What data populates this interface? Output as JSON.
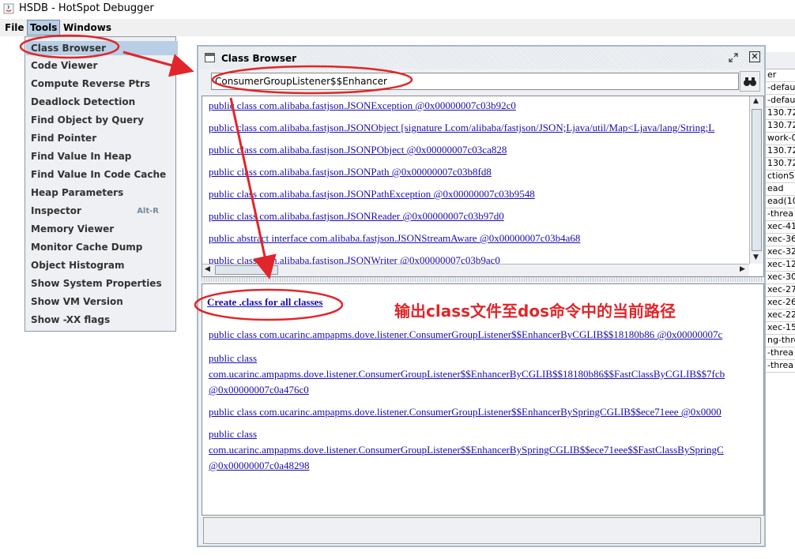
{
  "app": {
    "title": "HSDB - HotSpot Debugger"
  },
  "menubar": {
    "items": [
      "File",
      "Tools",
      "Windows"
    ]
  },
  "tools_menu": {
    "items": [
      {
        "label": "Class Browser",
        "shortcut": ""
      },
      {
        "label": "Code Viewer",
        "shortcut": ""
      },
      {
        "label": "Compute Reverse Ptrs",
        "shortcut": ""
      },
      {
        "label": "Deadlock Detection",
        "shortcut": ""
      },
      {
        "label": "Find Object by Query",
        "shortcut": ""
      },
      {
        "label": "Find Pointer",
        "shortcut": ""
      },
      {
        "label": "Find Value In Heap",
        "shortcut": ""
      },
      {
        "label": "Find Value In Code Cache",
        "shortcut": ""
      },
      {
        "label": "Heap Parameters",
        "shortcut": ""
      },
      {
        "label": "Inspector",
        "shortcut": "Alt-R"
      },
      {
        "label": "Memory Viewer",
        "shortcut": ""
      },
      {
        "label": "Monitor Cache Dump",
        "shortcut": ""
      },
      {
        "label": "Object Histogram",
        "shortcut": ""
      },
      {
        "label": "Show System Properties",
        "shortcut": ""
      },
      {
        "label": "Show VM Version",
        "shortcut": ""
      },
      {
        "label": "Show -XX flags",
        "shortcut": ""
      }
    ]
  },
  "class_browser": {
    "title": "Class Browser",
    "search_value": "ConsumerGroupListener$$Enhancer",
    "top_list": [
      "public class com.alibaba.fastjson.JSONException @0x00000007c03b92c0",
      "public class com.alibaba.fastjson.JSONObject [signature Lcom/alibaba/fastjson/JSON;Ljava/util/Map<Ljava/lang/String;L",
      "public class com.alibaba.fastjson.JSONPObject @0x00000007c03ca828",
      "public class com.alibaba.fastjson.JSONPath @0x00000007c03b8fd8",
      "public class com.alibaba.fastjson.JSONPathException @0x00000007c03b9548",
      "public class com.alibaba.fastjson.JSONReader @0x00000007c03b97d0",
      "public abstract interface com.alibaba.fastjson.JSONStreamAware @0x00000007c03b4a68",
      "public class com.alibaba.fastjson.JSONWriter @0x00000007c03b9ac0"
    ],
    "create_link": "Create .class for all classes",
    "bottom_list": [
      [
        "public class com.ucarinc.ampapms.dove.listener.ConsumerGroupListener$$EnhancerByCGLIB$$18180b86 @0x00000007c"
      ],
      [
        "public class",
        "com.ucarinc.ampapms.dove.listener.ConsumerGroupListener$$EnhancerByCGLIB$$18180b86$$FastClassByCGLIB$$7fcb",
        "@0x00000007c0a476c0"
      ],
      [
        "public class com.ucarinc.ampapms.dove.listener.ConsumerGroupListener$$EnhancerBySpringCGLIB$$ece71eee @0x0000"
      ],
      [
        "public class",
        "com.ucarinc.ampapms.dove.listener.ConsumerGroupListener$$EnhancerBySpringCGLIB$$ece71eee$$FastClassBySpringC",
        " @0x00000007c0a48298"
      ]
    ]
  },
  "annotation": {
    "text": "输出class文件至dos命令中的当前路径",
    "color": "#e0262a"
  },
  "background_window": {
    "rows": [
      "er",
      "-defau",
      "-defau",
      "130.72",
      "130.72",
      "work-0",
      "130.72",
      "130.72",
      "ctionS",
      "ead",
      "ead(10",
      "-threa",
      "xec-41",
      "xec-36",
      "xec-32",
      "xec-12",
      "xec-30",
      "xec-27",
      "xec-26",
      "xec-22",
      "xec-15",
      "ng-thre",
      "-threa",
      "-threa"
    ]
  }
}
